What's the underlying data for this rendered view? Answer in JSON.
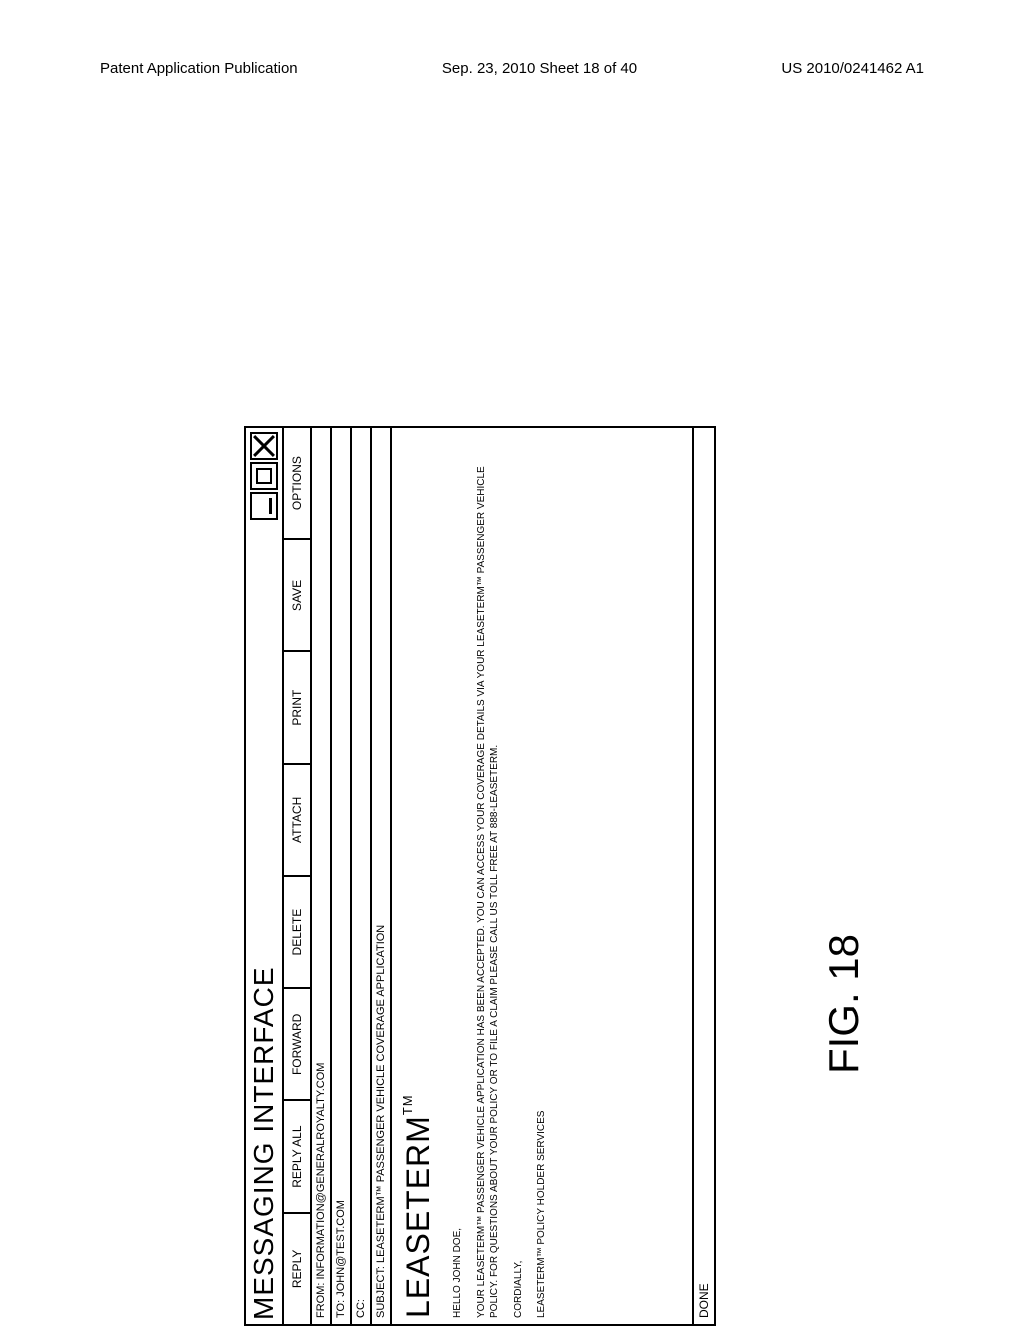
{
  "page_header": {
    "left": "Patent Application Publication",
    "center": "Sep. 23, 2010  Sheet 18 of 40",
    "right": "US 2010/0241462 A1"
  },
  "window": {
    "title": "MESSAGING INTERFACE"
  },
  "toolbar": {
    "reply": "REPLY",
    "reply_all": "REPLY ALL",
    "forward": "FORWARD",
    "delete": "DELETE",
    "attach": "ATTACH",
    "print": "PRINT",
    "save": "SAVE",
    "options": "OPTIONS"
  },
  "headers": {
    "from": "FROM: INFORMATION@GENERALROYALTY.COM",
    "to": "TO: JOHN@TEST.COM",
    "cc": "CC:",
    "subject": "SUBJECT: LEASETERM™ PASSENGER VEHICLE COVERAGE APPLICATION"
  },
  "body": {
    "brand": "LEASETERM",
    "brand_tm": "TM",
    "greeting": "HELLO JOHN DOE,",
    "para1": "YOUR LEASETERM™ PASSENGER VEHICLE APPLICATION HAS BEEN ACCEPTED.  YOU CAN ACCESS YOUR COVERAGE DETAILS VIA YOUR LEASETERM™ PASSENGER VEHICLE POLICY.  FOR QUESTIONS ABOUT YOUR POLICY OR TO FILE A CLAIM PLEASE CALL US TOLL FREE AT  888-LEASETERM.",
    "closing": "CORDIALLY,",
    "signature": "LEASETERM™ POLICY HOLDER SERVICES"
  },
  "statusbar": {
    "done": "DONE"
  },
  "figure_label": "FIG. 18"
}
